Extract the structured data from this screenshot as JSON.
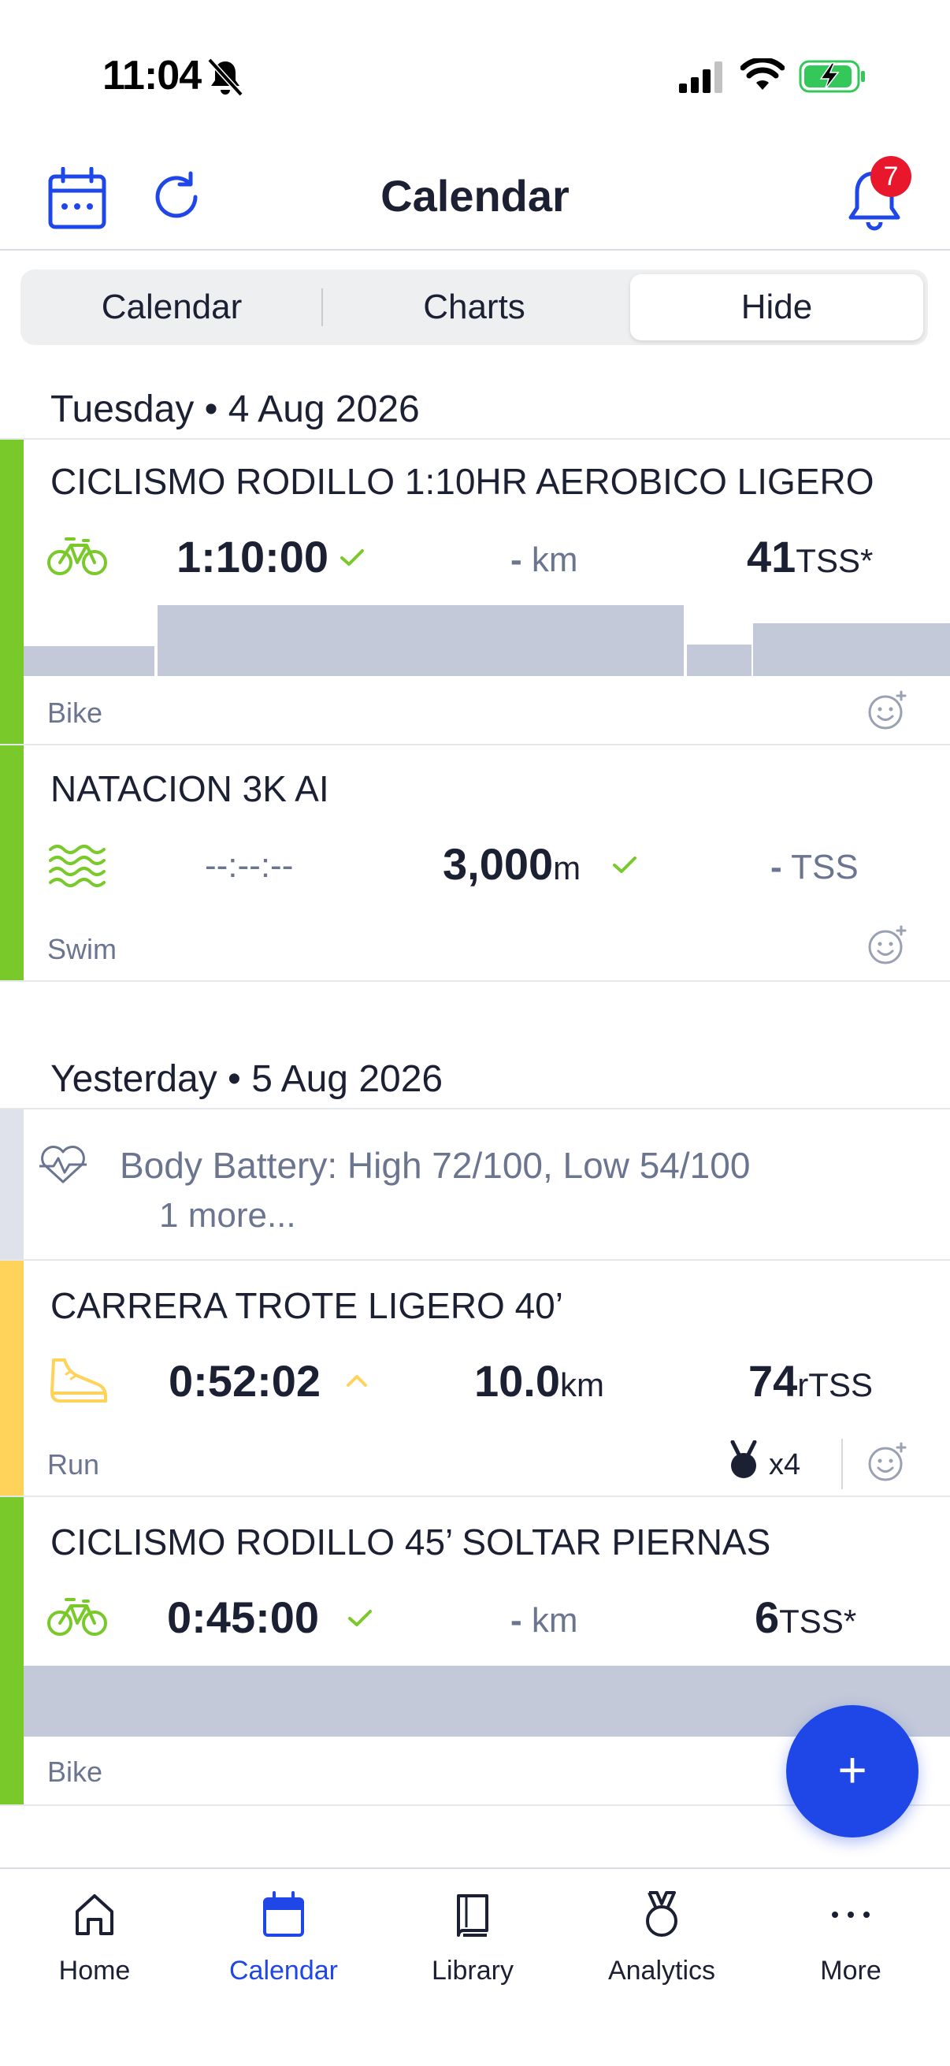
{
  "status_bar": {
    "time": "11:04"
  },
  "header": {
    "title": "Calendar",
    "notification_count": "7"
  },
  "segmented": {
    "options": [
      "Calendar",
      "Charts",
      "Hide"
    ],
    "selected": "Hide"
  },
  "days": [
    {
      "header": "Tuesday • 4 Aug 2026",
      "workouts": [
        {
          "title": "CICLISMO RODILLO 1:10HR AEROBICO LIGERO",
          "sport": "Bike",
          "duration": "1:10:00",
          "distance": "-",
          "distance_unit": "km",
          "tss": "41",
          "tss_unit": "TSS*",
          "color": "#7ac92a",
          "icon": "bike-icon",
          "graph_levels": [
            0.42,
            1.0,
            0.45,
            0.75
          ]
        },
        {
          "title": "NATACION 3K AI",
          "sport": "Swim",
          "duration": "--:--:--",
          "distance": "3,000",
          "distance_unit": "m",
          "tss": "-",
          "tss_unit": "TSS",
          "color": "#7ac92a",
          "icon": "swim-icon"
        }
      ]
    },
    {
      "header": "Yesterday • 5 Aug 2026",
      "metric": {
        "text": "Body Battery: High 72/100, Low 54/100",
        "more": "1 more...",
        "icon": "heart-pulse-icon"
      },
      "workouts": [
        {
          "title": "CARRERA TROTE LIGERO 40’",
          "sport": "Run",
          "duration": "0:52:02",
          "distance": "10.0",
          "distance_unit": "km",
          "tss": "74",
          "tss_unit": "rTSS",
          "color": "#ffd25a",
          "icon": "shoe-icon",
          "medals": "x4"
        },
        {
          "title": "CICLISMO RODILLO 45’ SOLTAR PIERNAS",
          "sport": "Bike",
          "duration": "0:45:00",
          "distance": "-",
          "distance_unit": "km",
          "tss": "6",
          "tss_unit": "TSS*",
          "color": "#7ac92a",
          "icon": "bike-icon"
        }
      ]
    }
  ],
  "fab": {
    "label": "+"
  },
  "bottom_nav": [
    {
      "label": "Home",
      "icon": "home-icon",
      "active": false
    },
    {
      "label": "Calendar",
      "icon": "calendar-icon",
      "active": true
    },
    {
      "label": "Library",
      "icon": "book-icon",
      "active": false
    },
    {
      "label": "Analytics",
      "icon": "medal-icon",
      "active": false
    },
    {
      "label": "More",
      "icon": "more-icon",
      "active": false
    }
  ],
  "colors": {
    "accent": "#1f47e8",
    "bike_swim": "#7ac92a",
    "run": "#ffd25a",
    "badge": "#e8172c"
  }
}
